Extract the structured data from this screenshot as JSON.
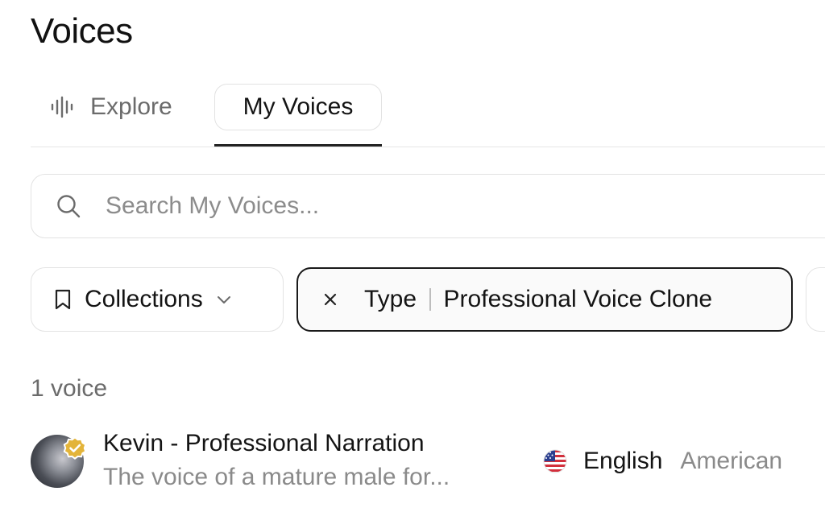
{
  "page": {
    "title": "Voices"
  },
  "tabs": [
    {
      "label": "Explore",
      "icon": "waveform-icon",
      "active": false
    },
    {
      "label": "My Voices",
      "active": true
    }
  ],
  "search": {
    "placeholder": "Search My Voices...",
    "value": ""
  },
  "filters": {
    "collections_label": "Collections",
    "type_key": "Type",
    "type_value": "Professional Voice Clone"
  },
  "results": {
    "count_label": "1 voice"
  },
  "voices": [
    {
      "name": "Kevin - Professional Narration",
      "description": "The voice of a mature male for...",
      "language": "English",
      "accent": "American",
      "verified": true
    }
  ],
  "colors": {
    "verified_badge": "#e3b43a",
    "active_border": "#1a1a1a",
    "muted_text": "#8a8a8a"
  }
}
